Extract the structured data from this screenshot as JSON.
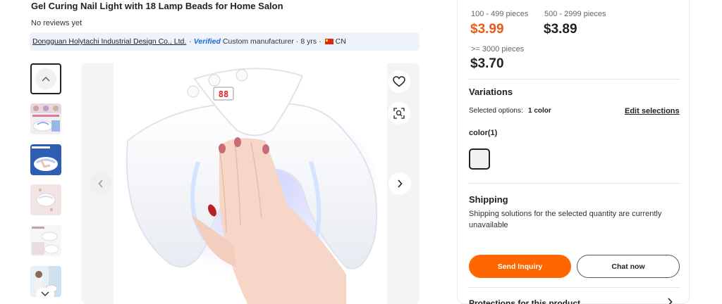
{
  "product": {
    "title": "Gel Curing Nail Light with 18 Lamp Beads for Home Salon",
    "reviews": "No reviews yet"
  },
  "supplier": {
    "name": "Dongguan Holytachi Industrial Design Co., Ltd.",
    "sep1": "·",
    "verified": "Verified",
    "type": "Custom manufacturer",
    "sep2": "·",
    "years": "8 yrs",
    "sep3": "·",
    "country": "CN"
  },
  "gallery": {
    "thumbnail_count": 6,
    "active_index": 0,
    "display_digits": "88"
  },
  "pricing": {
    "tiers": [
      {
        "qty": "100 - 499 pieces",
        "price": "$3.99"
      },
      {
        "qty": "500 - 2999 pieces",
        "price": "$3.89"
      },
      {
        "qty": ">= 3000 pieces",
        "price": "$3.70"
      }
    ]
  },
  "variations": {
    "title": "Variations",
    "selected_label": "Selected options:",
    "selected_value": "1 color",
    "edit_link": "Edit selections",
    "color_label": "color(1)"
  },
  "shipping": {
    "title": "Shipping",
    "text": "Shipping solutions for the selected quantity are currently unavailable"
  },
  "actions": {
    "send_inquiry": "Send Inquiry",
    "chat_now": "Chat now"
  },
  "protections": {
    "title": "Protections for this product"
  },
  "colors": {
    "accent": "#ff6600",
    "price_highlight": "#e85a16",
    "verified_blue": "#1a6bd6",
    "supplier_bar": "#eef3fb"
  },
  "icons": [
    "chevron-up-icon",
    "chevron-down-icon",
    "chevron-left-icon",
    "chevron-right-icon",
    "heart-icon",
    "image-search-icon",
    "flag-cn-icon"
  ]
}
